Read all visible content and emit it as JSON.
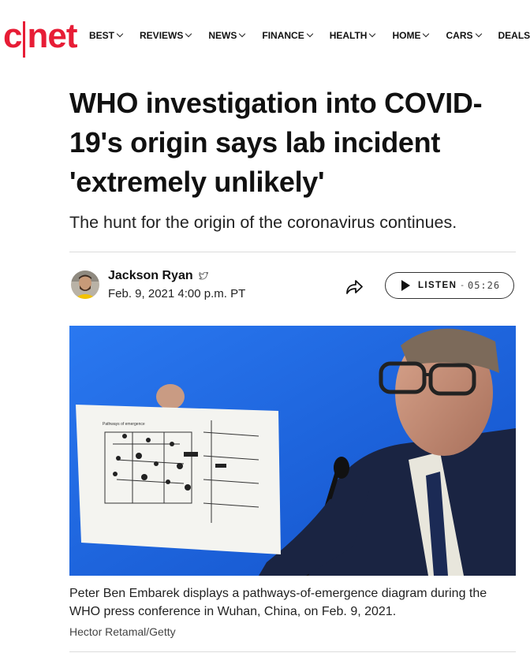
{
  "header": {
    "logo_text": "cnet",
    "nav": [
      {
        "label": "BEST"
      },
      {
        "label": "REVIEWS"
      },
      {
        "label": "NEWS"
      },
      {
        "label": "FINANCE"
      },
      {
        "label": "HEALTH"
      },
      {
        "label": "HOME"
      },
      {
        "label": "CARS"
      },
      {
        "label": "DEALS"
      }
    ]
  },
  "article": {
    "headline": "WHO investigation into COVID-19's origin says lab incident 'extremely unlikely'",
    "dek": "The hunt for the origin of the coronavirus continues.",
    "author": "Jackson Ryan",
    "date": "Feb. 9, 2021 4:00 p.m. PT",
    "listen": {
      "label": "LISTEN",
      "separator": "-",
      "duration": "05:26"
    },
    "image": {
      "caption": "Peter Ben Embarek displays a pathways-of-emergence diagram during the WHO press conference in Wuhan, China, on Feb. 9, 2021.",
      "credit": "Hector Retamal/Getty",
      "diagram_title": "Pathways of emergence"
    }
  },
  "colors": {
    "brand": "#e71d36",
    "photo_bg": "#1c6ae6",
    "text": "#111111"
  },
  "icons": {
    "share": "share-arrow-icon",
    "play": "play-icon",
    "twitter": "twitter-bird-icon",
    "chevron": "chevron-down-icon"
  }
}
